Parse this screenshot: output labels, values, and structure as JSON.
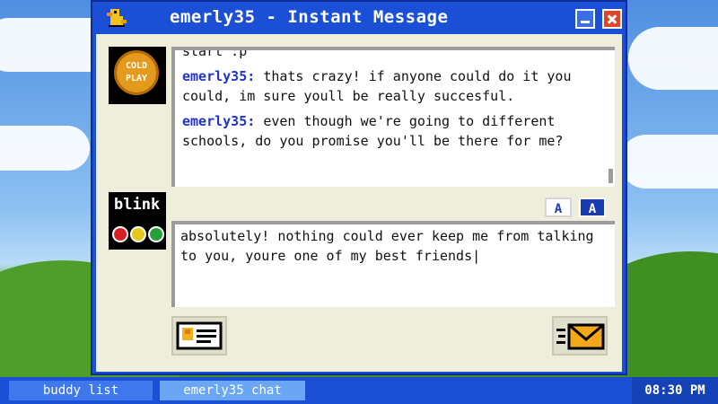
{
  "window": {
    "title": "emerly35 - Instant Message"
  },
  "avatars": {
    "top": {
      "line1": "COLD",
      "line2": "PLAY"
    },
    "bottom": {
      "label": "blink"
    }
  },
  "log": {
    "messages": [
      {
        "sender": "",
        "text": "start :p"
      },
      {
        "sender": "emerly35:",
        "text": "thats crazy! if anyone could do it you could, im sure youll be really succesful."
      },
      {
        "sender": "emerly35:",
        "text": "even though we're going to different schools, do you promise you'll be there for me?"
      }
    ]
  },
  "format_buttons": {
    "a": "A",
    "b": "A"
  },
  "compose": {
    "value": "absolutely! nothing could ever keep me from talking to you, youre one of my best friends|"
  },
  "taskbar": {
    "buddy_list": "buddy list",
    "chat": "emerly35 chat",
    "clock": "08:30 PM"
  },
  "colors": {
    "window_blue": "#1b4fd6",
    "sender_blue": "#2233c8",
    "client_bg": "#efeedd",
    "close_red": "#d9482a"
  },
  "icons": {
    "title": "duck-icon",
    "profile": "id-card-icon",
    "send": "envelope-send-icon",
    "minimize": "minimize-icon",
    "close": "close-icon"
  }
}
